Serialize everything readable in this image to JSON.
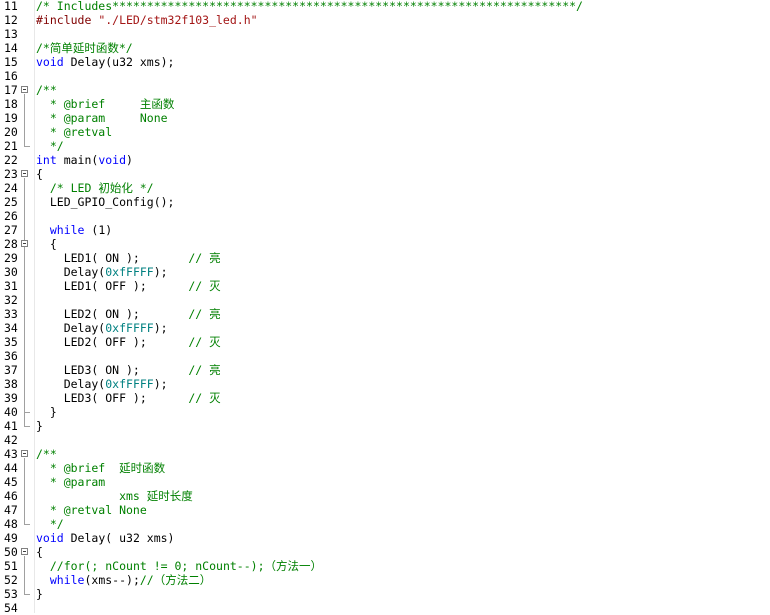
{
  "editor": {
    "lines": [
      {
        "no": "11",
        "fold": "",
        "tokens": [
          {
            "t": "cm",
            "v": "/* Includes*******************************************************************/"
          }
        ]
      },
      {
        "no": "12",
        "fold": "",
        "tokens": [
          {
            "t": "pp",
            "v": "#include "
          },
          {
            "t": "str",
            "v": "\"./LED/stm32f103_led.h\""
          }
        ]
      },
      {
        "no": "13",
        "fold": "",
        "tokens": []
      },
      {
        "no": "14",
        "fold": "",
        "tokens": [
          {
            "t": "cm",
            "v": "/*简单延时函数*/"
          }
        ]
      },
      {
        "no": "15",
        "fold": "",
        "tokens": [
          {
            "t": "kw",
            "v": "void"
          },
          {
            "t": "pl",
            "v": " Delay(u32 xms);"
          }
        ]
      },
      {
        "no": "16",
        "fold": "",
        "tokens": []
      },
      {
        "no": "17",
        "fold": "start",
        "tokens": [
          {
            "t": "cm",
            "v": "/**"
          }
        ]
      },
      {
        "no": "18",
        "fold": "",
        "tokens": [
          {
            "t": "cm",
            "v": "  * @brief     主函数"
          }
        ]
      },
      {
        "no": "19",
        "fold": "",
        "tokens": [
          {
            "t": "cm",
            "v": "  * @param     None"
          }
        ]
      },
      {
        "no": "20",
        "fold": "",
        "tokens": [
          {
            "t": "cm",
            "v": "  * @retval"
          }
        ]
      },
      {
        "no": "21",
        "fold": "end",
        "tokens": [
          {
            "t": "cm",
            "v": "  */"
          }
        ]
      },
      {
        "no": "22",
        "fold": "",
        "tokens": [
          {
            "t": "kw",
            "v": "int"
          },
          {
            "t": "pl",
            "v": " main("
          },
          {
            "t": "kw",
            "v": "void"
          },
          {
            "t": "pl",
            "v": ")"
          }
        ]
      },
      {
        "no": "23",
        "fold": "start",
        "tokens": [
          {
            "t": "pl",
            "v": "{"
          }
        ]
      },
      {
        "no": "24",
        "fold": "",
        "tokens": [
          {
            "t": "pl",
            "v": "  "
          },
          {
            "t": "cm",
            "v": "/* LED 初始化 */"
          }
        ]
      },
      {
        "no": "25",
        "fold": "",
        "tokens": [
          {
            "t": "pl",
            "v": "  LED_GPIO_Config();"
          }
        ]
      },
      {
        "no": "26",
        "fold": "",
        "tokens": []
      },
      {
        "no": "27",
        "fold": "",
        "tokens": [
          {
            "t": "pl",
            "v": "  "
          },
          {
            "t": "kw",
            "v": "while"
          },
          {
            "t": "pl",
            "v": " (1)"
          }
        ]
      },
      {
        "no": "28",
        "fold": "start",
        "tokens": [
          {
            "t": "pl",
            "v": "  {"
          }
        ]
      },
      {
        "no": "29",
        "fold": "",
        "tokens": [
          {
            "t": "pl",
            "v": "    LED1( ON );       "
          },
          {
            "t": "cm",
            "v": "// 亮"
          }
        ]
      },
      {
        "no": "30",
        "fold": "",
        "tokens": [
          {
            "t": "pl",
            "v": "    Delay("
          },
          {
            "t": "num",
            "v": "0xfFFFF"
          },
          {
            "t": "pl",
            "v": ");"
          }
        ]
      },
      {
        "no": "31",
        "fold": "",
        "tokens": [
          {
            "t": "pl",
            "v": "    LED1( OFF );      "
          },
          {
            "t": "cm",
            "v": "// 灭"
          }
        ]
      },
      {
        "no": "32",
        "fold": "",
        "tokens": []
      },
      {
        "no": "33",
        "fold": "",
        "tokens": [
          {
            "t": "pl",
            "v": "    LED2( ON );       "
          },
          {
            "t": "cm",
            "v": "// 亮"
          }
        ]
      },
      {
        "no": "34",
        "fold": "",
        "tokens": [
          {
            "t": "pl",
            "v": "    Delay("
          },
          {
            "t": "num",
            "v": "0xfFFFF"
          },
          {
            "t": "pl",
            "v": ");"
          }
        ]
      },
      {
        "no": "35",
        "fold": "",
        "tokens": [
          {
            "t": "pl",
            "v": "    LED2( OFF );      "
          },
          {
            "t": "cm",
            "v": "// 灭"
          }
        ]
      },
      {
        "no": "36",
        "fold": "",
        "tokens": []
      },
      {
        "no": "37",
        "fold": "",
        "tokens": [
          {
            "t": "pl",
            "v": "    LED3( ON );       "
          },
          {
            "t": "cm",
            "v": "// 亮"
          }
        ]
      },
      {
        "no": "38",
        "fold": "",
        "tokens": [
          {
            "t": "pl",
            "v": "    Delay("
          },
          {
            "t": "num",
            "v": "0xfFFFF"
          },
          {
            "t": "pl",
            "v": ");"
          }
        ]
      },
      {
        "no": "39",
        "fold": "",
        "tokens": [
          {
            "t": "pl",
            "v": "    LED3( OFF );      "
          },
          {
            "t": "cm",
            "v": "// 灭"
          }
        ]
      },
      {
        "no": "40",
        "fold": "end",
        "tokens": [
          {
            "t": "pl",
            "v": "  }"
          }
        ]
      },
      {
        "no": "41",
        "fold": "end",
        "tokens": [
          {
            "t": "pl",
            "v": "}"
          }
        ]
      },
      {
        "no": "42",
        "fold": "",
        "tokens": []
      },
      {
        "no": "43",
        "fold": "start",
        "tokens": [
          {
            "t": "cm",
            "v": "/**"
          }
        ]
      },
      {
        "no": "44",
        "fold": "",
        "tokens": [
          {
            "t": "cm",
            "v": "  * @brief  延时函数"
          }
        ]
      },
      {
        "no": "45",
        "fold": "",
        "tokens": [
          {
            "t": "cm",
            "v": "  * @param"
          }
        ]
      },
      {
        "no": "46",
        "fold": "",
        "tokens": [
          {
            "t": "cm",
            "v": "            xms 延时长度"
          }
        ]
      },
      {
        "no": "47",
        "fold": "",
        "tokens": [
          {
            "t": "cm",
            "v": "  * @retval None"
          }
        ]
      },
      {
        "no": "48",
        "fold": "end",
        "tokens": [
          {
            "t": "cm",
            "v": "  */"
          }
        ]
      },
      {
        "no": "49",
        "fold": "",
        "tokens": [
          {
            "t": "kw",
            "v": "void"
          },
          {
            "t": "pl",
            "v": " Delay( u32 xms)"
          }
        ]
      },
      {
        "no": "50",
        "fold": "start",
        "tokens": [
          {
            "t": "pl",
            "v": "{"
          }
        ]
      },
      {
        "no": "51",
        "fold": "",
        "tokens": [
          {
            "t": "pl",
            "v": "  "
          },
          {
            "t": "cm",
            "v": "//for(; nCount != 0; nCount--);（方法一）"
          }
        ]
      },
      {
        "no": "52",
        "fold": "",
        "tokens": [
          {
            "t": "pl",
            "v": "  "
          },
          {
            "t": "kw",
            "v": "while"
          },
          {
            "t": "pl",
            "v": "(xms--);"
          },
          {
            "t": "cm",
            "v": "//（方法二）"
          }
        ]
      },
      {
        "no": "53",
        "fold": "end",
        "tokens": [
          {
            "t": "pl",
            "v": "}"
          }
        ]
      },
      {
        "no": "54",
        "fold": "",
        "tokens": []
      }
    ]
  }
}
